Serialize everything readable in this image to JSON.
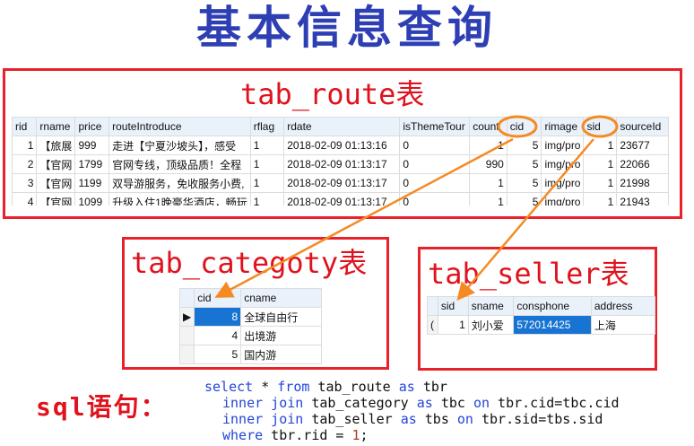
{
  "title": "基本信息查询",
  "route_box": {
    "label": "tab_route表",
    "columns": [
      "rid",
      "rname",
      "price",
      "routeIntroduce",
      "rflag",
      "rdate",
      "isThemeTour",
      "count",
      "cid",
      "rimage",
      "sid",
      "sourceId"
    ],
    "rows": [
      [
        "1",
        "【旅展",
        "999",
        "走进【宁夏沙坡头】，感受",
        "1",
        "2018-02-09 01:13:16",
        "0",
        "1",
        "5",
        "img/pro",
        "1",
        "23677"
      ],
      [
        "2",
        "【官网",
        "1799",
        "官网专线，顶级品质！全程",
        "1",
        "2018-02-09 01:13:17",
        "0",
        "990",
        "5",
        "img/pro",
        "1",
        "22066"
      ],
      [
        "3",
        "【官网",
        "1199",
        "双导游服务，免收服务小费,",
        "1",
        "2018-02-09 01:13:17",
        "0",
        "1",
        "5",
        "img/pro",
        "1",
        "21998"
      ],
      [
        "4",
        "【官网",
        "1099",
        "升级入住1晚豪华酒店，畅玩",
        "1",
        "2018-02-09 01:13:17",
        "0",
        "1",
        "5",
        "img/pro",
        "1",
        "21943"
      ]
    ]
  },
  "category_box": {
    "label": "tab_categoty表",
    "columns": [
      "cid",
      "cname"
    ],
    "rows": [
      [
        "8",
        "全球自由行"
      ],
      [
        "4",
        "出境游"
      ],
      [
        "5",
        "国内游"
      ]
    ]
  },
  "seller_box": {
    "label": "tab_seller表",
    "columns": [
      "sid",
      "sname",
      "consphone",
      "address"
    ],
    "rows": [
      [
        "1",
        "刘小爱",
        "572014425",
        "上海"
      ]
    ]
  },
  "sql": {
    "label": "sql语句：",
    "line1": {
      "k1": "select",
      "t1": " * ",
      "k2": "from",
      "t2": " tab_route ",
      "k3": "as",
      "t3": " tbr"
    },
    "line2": {
      "k1": "inner join",
      "t1": " tab_category ",
      "k2": "as",
      "t2": " tbc ",
      "k3": "on",
      "t3": " tbr.cid=tbc.cid"
    },
    "line3": {
      "k1": "inner join",
      "t1": " tab_seller ",
      "k2": "as",
      "t2": " tbs ",
      "k3": "on",
      "t3": " tbr.sid=tbs.sid"
    },
    "line4": {
      "k1": "where",
      "t1": " tbr.rid = ",
      "n1": "1",
      "t2": ";"
    }
  },
  "colors": {
    "title": "#2e3fb4",
    "box_border": "#e8222a",
    "label": "#e0121d",
    "arrow": "#f58a22",
    "keyword": "#2345d8",
    "selection": "#1874d2"
  }
}
